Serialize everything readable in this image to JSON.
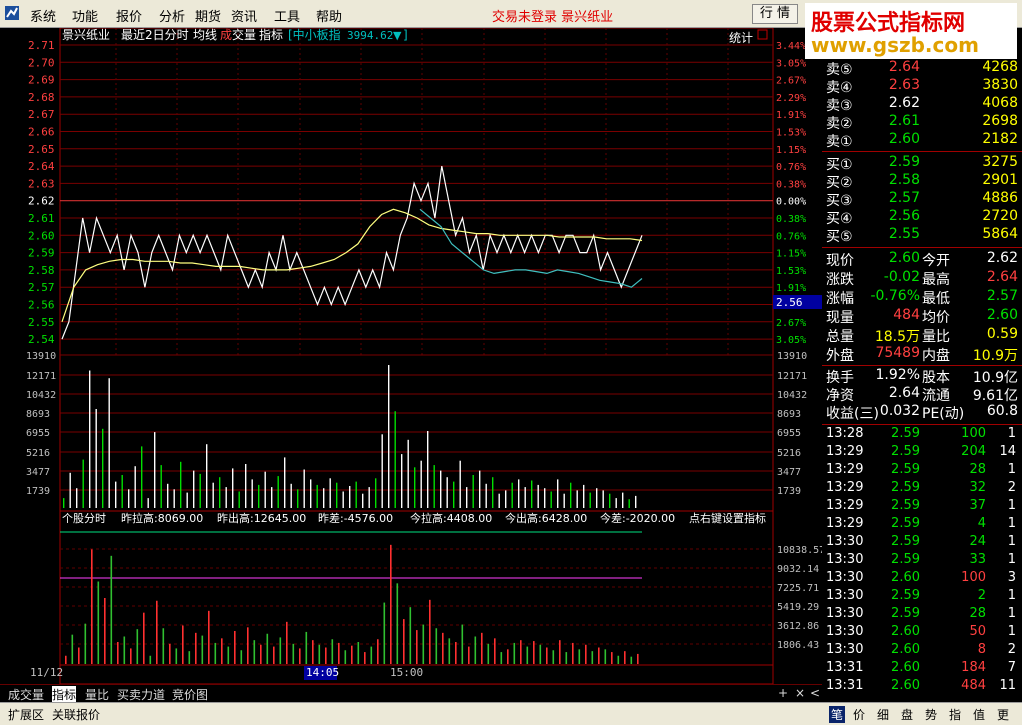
{
  "menu": [
    "系统",
    "功能",
    "报价",
    "分析",
    "期货",
    "资讯",
    "工具",
    "帮助"
  ],
  "title_info": "交易未登录  景兴纸业",
  "quote_button": "行 情",
  "watermark": {
    "line1": "股票公式指标网",
    "line2": "www.gszb.com"
  },
  "header": {
    "stock": "景兴纸业",
    "mode": "最近2日分时",
    "avg": "均线",
    "vol_a": "成",
    "vol_b": "交量",
    "indicator": "指标",
    "index_name": "[中小板指",
    "index_value": "3994.62",
    "index_arrow": "▼",
    "index_close": "]",
    "stats": "统计"
  },
  "price_ticks": [
    "2.71",
    "2.70",
    "2.69",
    "2.68",
    "2.67",
    "2.66",
    "2.65",
    "2.64",
    "2.63",
    "2.62",
    "2.61",
    "2.60",
    "2.59",
    "2.58",
    "2.57",
    "2.56",
    "2.55",
    "2.54"
  ],
  "pct_ticks": [
    "3.44%",
    "3.05%",
    "2.67%",
    "2.29%",
    "1.91%",
    "1.53%",
    "1.15%",
    "0.76%",
    "0.38%",
    "0.00%",
    "0.38%",
    "0.76%",
    "1.15%",
    "1.53%",
    "1.91%",
    "2.29%",
    "2.67%",
    "3.05%"
  ],
  "current_price_label": "2.56",
  "vol_ticks": [
    "13910",
    "12171",
    "10432",
    "8693",
    "6955",
    "5216",
    "3477",
    "1739"
  ],
  "ind_header": {
    "name": "个股分时",
    "y_pull": "昨拉高:8069.00",
    "y_out": "昨出高:12645.00",
    "y_diff": "昨差:-4576.00",
    "t_pull": "今拉高:4408.00",
    "t_out": "今出高:6428.00",
    "t_diff": "今差:-2020.00",
    "hint": "点右键设置指标"
  },
  "ind_ticks": [
    "10838.57",
    "9032.14",
    "7225.71",
    "5419.29",
    "3612.86",
    "1806.43"
  ],
  "x_labels": {
    "d1": "11/12",
    "t1": "14:05",
    "t2": "15:00"
  },
  "bottom_tabs": [
    "成交量",
    "指标",
    "量比",
    "买卖力道",
    "竞价图"
  ],
  "bottom_tab_selected": 1,
  "bottom_icons": [
    "+",
    "×",
    "<",
    ">"
  ],
  "status_left": [
    "扩展区",
    "关联报价"
  ],
  "right_tabs": [
    "笔",
    "价",
    "细",
    "盘",
    "势",
    "指",
    "值",
    "更"
  ],
  "ask": [
    {
      "label": "卖⑤",
      "price": "2.64",
      "vol": "4268",
      "pc": "#ff4040"
    },
    {
      "label": "卖④",
      "price": "2.63",
      "vol": "3830",
      "pc": "#ff4040"
    },
    {
      "label": "卖③",
      "price": "2.62",
      "vol": "4068",
      "pc": "#ffffff"
    },
    {
      "label": "卖②",
      "price": "2.61",
      "vol": "2698",
      "pc": "#00e000"
    },
    {
      "label": "卖①",
      "price": "2.60",
      "vol": "2182",
      "pc": "#00e000"
    }
  ],
  "bid": [
    {
      "label": "买①",
      "price": "2.59",
      "vol": "3275",
      "pc": "#00e000"
    },
    {
      "label": "买②",
      "price": "2.58",
      "vol": "2901",
      "pc": "#00e000"
    },
    {
      "label": "买③",
      "price": "2.57",
      "vol": "4886",
      "pc": "#00e000"
    },
    {
      "label": "买④",
      "price": "2.56",
      "vol": "2720",
      "pc": "#00e000"
    },
    {
      "label": "买⑤",
      "price": "2.55",
      "vol": "5864",
      "pc": "#00e000"
    }
  ],
  "quote": [
    {
      "l1": "现价",
      "v1": "2.60",
      "c1": "#00e000",
      "l2": "今开",
      "v2": "2.62",
      "c2": "#ffffff"
    },
    {
      "l1": "涨跌",
      "v1": "-0.02",
      "c1": "#00e000",
      "l2": "最高",
      "v2": "2.64",
      "c2": "#ff4040"
    },
    {
      "l1": "涨幅",
      "v1": "-0.76%",
      "c1": "#00e000",
      "l2": "最低",
      "v2": "2.57",
      "c2": "#00e000"
    },
    {
      "l1": "现量",
      "v1": "484",
      "c1": "#ff4040",
      "l2": "均价",
      "v2": "2.60",
      "c2": "#00e000"
    },
    {
      "l1": "总量",
      "v1": "18.5万",
      "c1": "#ffff00",
      "l2": "量比",
      "v2": "0.59",
      "c2": "#ffff00"
    },
    {
      "l1": "外盘",
      "v1": "75489",
      "c1": "#ff4040",
      "l2": "内盘",
      "v2": "10.9万",
      "c2": "#ffff00"
    }
  ],
  "fund": [
    {
      "l1": "换手",
      "v1": "1.92%",
      "l2": "股本",
      "v2": "10.9亿"
    },
    {
      "l1": "净资",
      "v1": "2.64",
      "l2": "流通",
      "v2": "9.61亿"
    },
    {
      "l1": "收益(三)",
      "v1": "0.032",
      "l2": "PE(动)",
      "v2": "60.8"
    }
  ],
  "ticks": [
    {
      "t": "13:28",
      "p": "2.59",
      "pc": "#00e000",
      "v": "100",
      "vc": "#00e000",
      "n": "1"
    },
    {
      "t": "13:29",
      "p": "2.59",
      "pc": "#00e000",
      "v": "204",
      "vc": "#00e000",
      "n": "14"
    },
    {
      "t": "13:29",
      "p": "2.59",
      "pc": "#00e000",
      "v": "28",
      "vc": "#00e000",
      "n": "1"
    },
    {
      "t": "13:29",
      "p": "2.59",
      "pc": "#00e000",
      "v": "32",
      "vc": "#00e000",
      "n": "2"
    },
    {
      "t": "13:29",
      "p": "2.59",
      "pc": "#00e000",
      "v": "37",
      "vc": "#00e000",
      "n": "1"
    },
    {
      "t": "13:29",
      "p": "2.59",
      "pc": "#00e000",
      "v": "4",
      "vc": "#00e000",
      "n": "1"
    },
    {
      "t": "13:30",
      "p": "2.59",
      "pc": "#00e000",
      "v": "24",
      "vc": "#00e000",
      "n": "1"
    },
    {
      "t": "13:30",
      "p": "2.59",
      "pc": "#00e000",
      "v": "33",
      "vc": "#00e000",
      "n": "1"
    },
    {
      "t": "13:30",
      "p": "2.60",
      "pc": "#00e000",
      "v": "100",
      "vc": "#ff4040",
      "n": "3"
    },
    {
      "t": "13:30",
      "p": "2.59",
      "pc": "#00e000",
      "v": "2",
      "vc": "#00e000",
      "n": "1"
    },
    {
      "t": "13:30",
      "p": "2.59",
      "pc": "#00e000",
      "v": "28",
      "vc": "#00e000",
      "n": "1"
    },
    {
      "t": "13:30",
      "p": "2.60",
      "pc": "#00e000",
      "v": "50",
      "vc": "#ff4040",
      "n": "1"
    },
    {
      "t": "13:30",
      "p": "2.60",
      "pc": "#00e000",
      "v": "8",
      "vc": "#ff4040",
      "n": "2"
    },
    {
      "t": "13:31",
      "p": "2.60",
      "pc": "#00e000",
      "v": "184",
      "vc": "#ff4040",
      "n": "7"
    },
    {
      "t": "13:31",
      "p": "2.60",
      "pc": "#00e000",
      "v": "484",
      "vc": "#ff4040",
      "n": "11"
    }
  ],
  "chart_data": {
    "type": "line",
    "x": "minutes (2 sessions, 11/12 & today)",
    "y_range": [
      2.535,
      2.715
    ],
    "prev_close": 2.62,
    "series": [
      {
        "values": [
          2.54,
          2.55,
          2.58,
          2.61,
          2.59,
          2.61,
          2.6,
          2.59,
          2.6,
          2.58,
          2.6,
          2.59,
          2.57,
          2.59,
          2.6,
          2.59,
          2.58,
          2.6,
          2.59,
          2.6,
          2.59,
          2.6,
          2.59,
          2.58,
          2.6,
          2.59,
          2.58,
          2.57,
          2.58,
          2.57,
          2.59,
          2.58,
          2.6,
          2.58,
          2.59,
          2.58,
          2.57,
          2.56,
          2.57,
          2.56,
          2.57,
          2.56,
          2.57,
          2.58,
          2.57,
          2.58,
          2.57,
          2.59,
          2.58,
          2.6,
          2.61,
          2.63,
          2.62,
          2.63,
          2.61,
          2.64,
          2.62,
          2.6,
          2.61,
          2.59,
          2.6,
          2.58,
          2.6,
          2.59,
          2.6,
          2.59,
          2.6,
          2.59,
          2.6,
          2.59,
          2.6,
          2.6,
          2.59,
          2.6,
          2.6,
          2.59,
          2.59,
          2.6,
          2.58,
          2.59,
          2.58,
          2.57,
          2.58,
          2.59,
          2.6
        ]
      },
      {
        "values": [
          2.55,
          2.57,
          2.58,
          2.583,
          2.585,
          2.586,
          2.586,
          2.585,
          2.585,
          2.585,
          2.584,
          2.584,
          2.583,
          2.582,
          2.582,
          2.582,
          2.581,
          2.58,
          2.58,
          2.58,
          2.581,
          2.582,
          2.584,
          2.586,
          2.59,
          2.595,
          2.605,
          2.612,
          2.615,
          2.613,
          2.61,
          2.606,
          2.604,
          2.603,
          2.602,
          2.601,
          2.601,
          2.6,
          2.6,
          2.6,
          2.6,
          2.6,
          2.599,
          2.599,
          2.599,
          2.599,
          2.598,
          2.598,
          2.598,
          2.597
        ]
      },
      {
        "values": [
          2.615,
          2.61,
          2.605,
          2.595,
          2.59,
          2.585,
          2.58,
          2.578,
          2.579,
          2.58,
          2.58,
          2.579,
          2.578,
          2.58,
          2.579,
          2.578,
          2.576,
          2.574,
          2.573,
          2.572,
          2.57,
          2.575
        ]
      }
    ],
    "volume": [
      900,
      3200,
      1800,
      4400,
      12500,
      9000,
      7200,
      11800,
      2400,
      3000,
      1700,
      3800,
      5600,
      900,
      6900,
      3900,
      2200,
      1700,
      4200,
      1400,
      3400,
      3100,
      5800,
      2300,
      2800,
      1900,
      3600,
      1500,
      4000,
      2600,
      2100,
      3300,
      1900,
      2900,
      4600,
      2200,
      1700,
      3500,
      2600,
      2100,
      1800,
      2700,
      2300,
      1500,
      2000,
      2400,
      1300,
      1900,
      2700,
      6700,
      13000,
      8800,
      4900,
      6200,
      3700,
      4300,
      7000,
      3900,
      3400,
      2800,
      2400,
      4300,
      1900,
      3000,
      3400,
      2200,
      2800,
      1300,
      1600,
      2300,
      2600,
      1900,
      2500,
      2100,
      1800,
      1500,
      2600,
      1300,
      2300,
      1600,
      2100,
      1400,
      1800,
      1600,
      1300,
      900,
      1400,
      800,
      1100
    ],
    "indicator_ranges": [
      0,
      12000
    ]
  }
}
